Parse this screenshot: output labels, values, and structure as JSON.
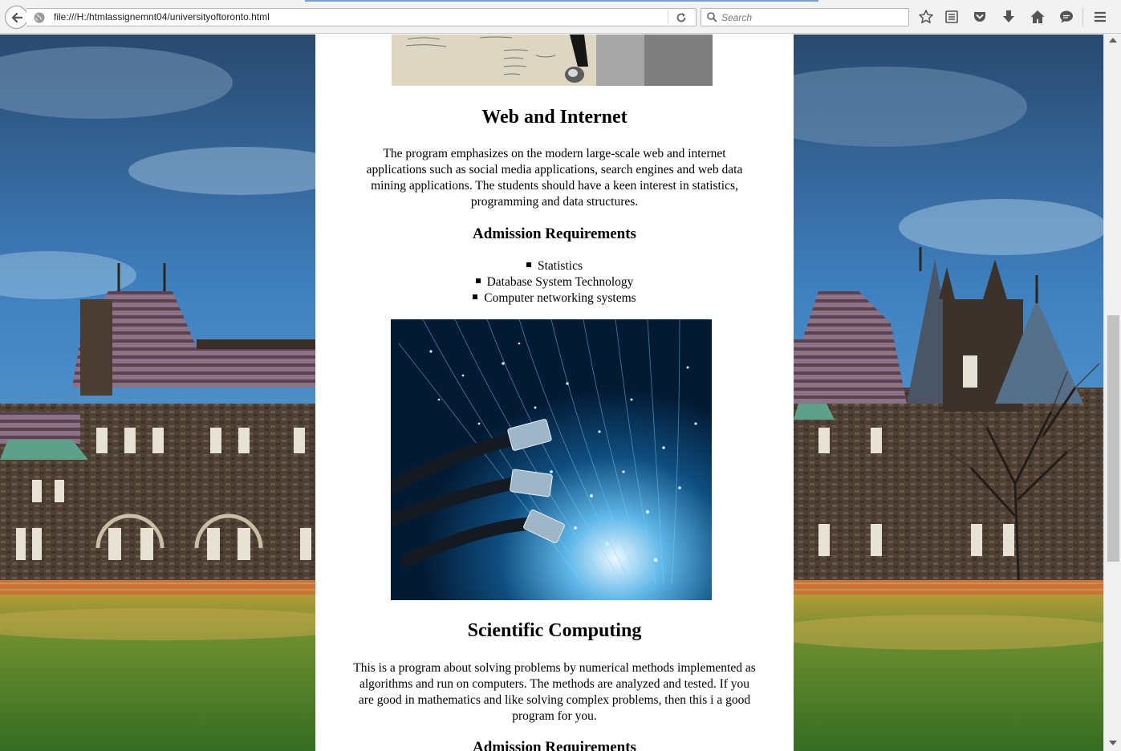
{
  "browser": {
    "url": "file:///H:/htmlassignemnt04/universityoftoronto.html",
    "search_placeholder": "Search"
  },
  "page": {
    "web_section": {
      "title": "Web and Internet",
      "description_lines": [
        "The program emphasizes on the modern large-scale web and internet",
        "applications such as social media applications, search engines and web data",
        "mining applications. The students should have a keen interest in statistics,",
        "programming and data structures."
      ],
      "requirements_heading": "Admission Requirements",
      "requirements": [
        "Statistics",
        "Database System Technology",
        "Computer networking systems"
      ]
    },
    "scientific_section": {
      "title": "Scientific Computing",
      "description_lines": [
        "This is a program about solving problems by numerical methods implemented as",
        "algorithms and run on computers. The methods are analyzed and tested. If you",
        "are good in mathematics and like solving complex problems, then this i a good",
        "program for you."
      ],
      "requirements_heading": "Admission Requirements"
    }
  },
  "colors": {
    "sky": "#3a78b8",
    "grass": "#4f8a2a",
    "stone": "#5a4a3c",
    "roof": "#8a6f7e",
    "fiber": "#0d4f7a"
  }
}
